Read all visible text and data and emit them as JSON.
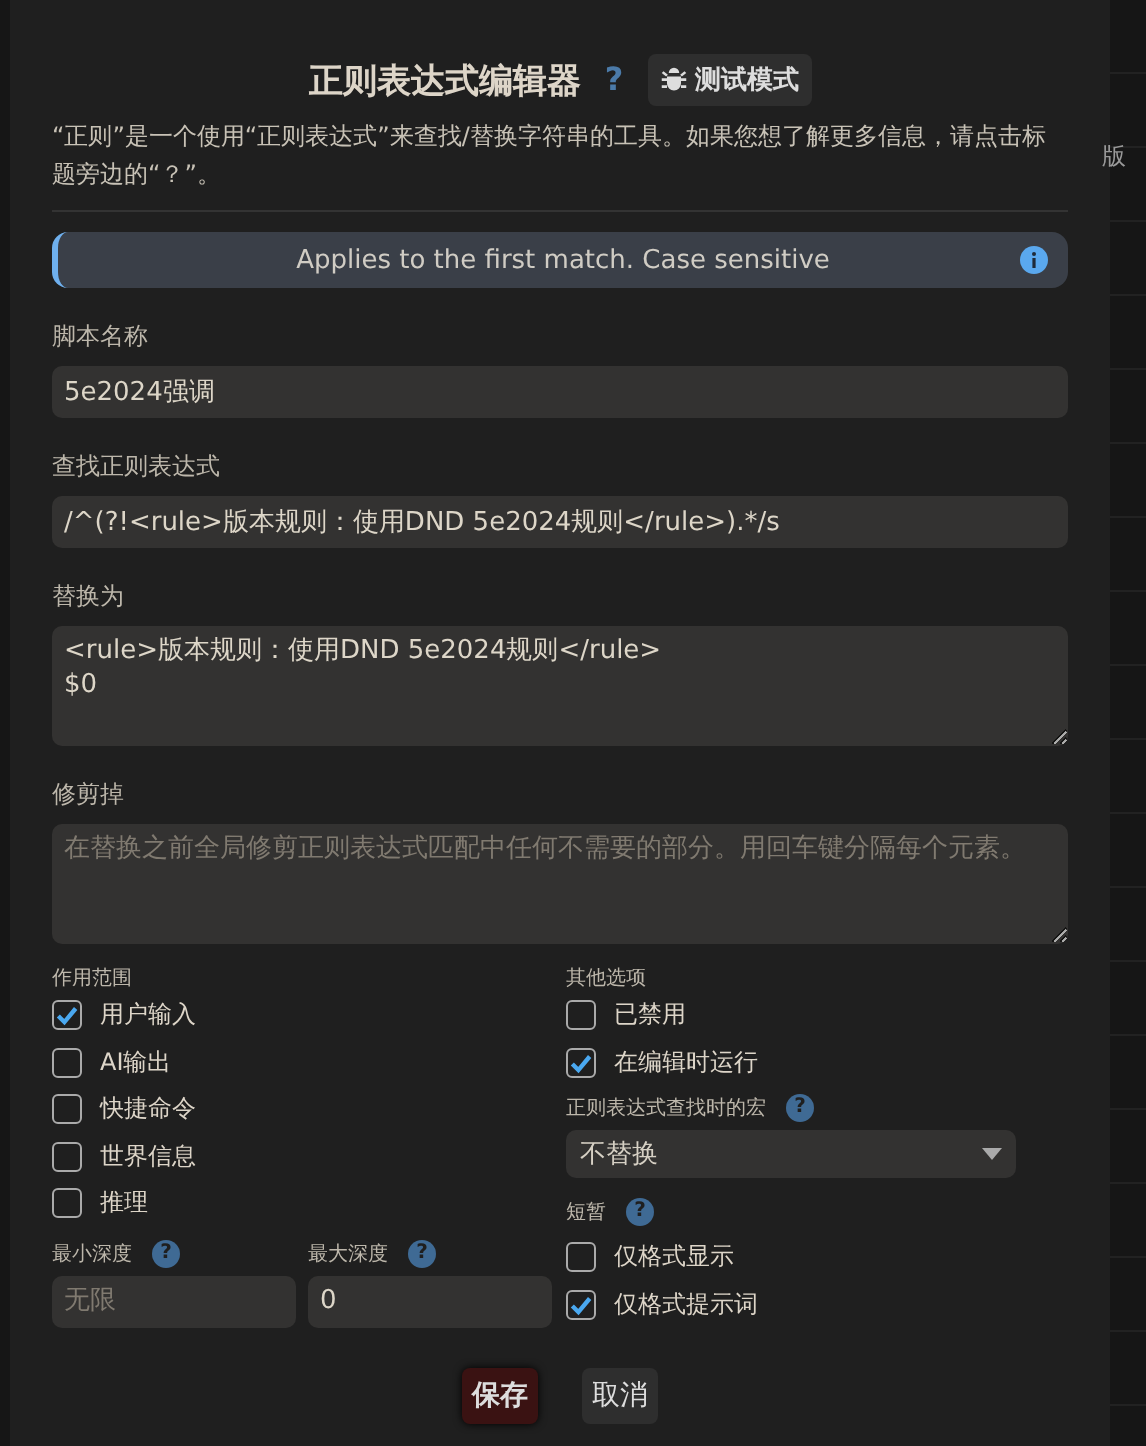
{
  "dialog": {
    "title": "正则表达式编辑器",
    "help": "?",
    "test_mode_button": "测试模式",
    "description": "“正则”是一个使用“正则表达式”来查找/替换字符串的工具。如果您想了解更多信息，请点击标题旁边的“？”。",
    "info_banner": "Applies to the first match. Case sensitive",
    "script_name": {
      "label": "脚本名称",
      "value": "5e2024强调"
    },
    "find_regex": {
      "label": "查找正则表达式",
      "value": "/^(?!<rule>版本规则：使用DND 5e2024规则</rule>).*/s"
    },
    "replace_with": {
      "label": "替换为",
      "value": "<rule>版本规则：使用DND 5e2024规则</rule>\n$0"
    },
    "trim_out": {
      "label": "修剪掉",
      "placeholder": "在替换之前全局修剪正则表达式匹配中任何不需要的部分。用回车键分隔每个元素。"
    },
    "scope": {
      "label": "作用范围",
      "options": [
        {
          "label": "用户输入",
          "checked": true
        },
        {
          "label": "AI输出",
          "checked": false
        },
        {
          "label": "快捷命令",
          "checked": false
        },
        {
          "label": "世界信息",
          "checked": false
        },
        {
          "label": "推理",
          "checked": false
        }
      ]
    },
    "min_depth": {
      "label": "最小深度",
      "help": "?",
      "placeholder": "无限"
    },
    "max_depth": {
      "label": "最大深度",
      "help": "?",
      "value": "0"
    },
    "other_options": {
      "label": "其他选项",
      "options": [
        {
          "label": "已禁用",
          "checked": false
        },
        {
          "label": "在编辑时运行",
          "checked": true
        }
      ]
    },
    "macro": {
      "label": "正则表达式查找时的宏",
      "help": "?",
      "value": "不替换"
    },
    "ephemeral": {
      "label": "短暂",
      "help": "?",
      "options": [
        {
          "label": "仅格式显示",
          "checked": false
        },
        {
          "label": "仅格式提示词",
          "checked": true
        }
      ]
    },
    "buttons": [
      {
        "label": "保存",
        "kind": "primary"
      },
      {
        "label": "取消",
        "kind": "secondary"
      }
    ]
  },
  "background_text": "版"
}
